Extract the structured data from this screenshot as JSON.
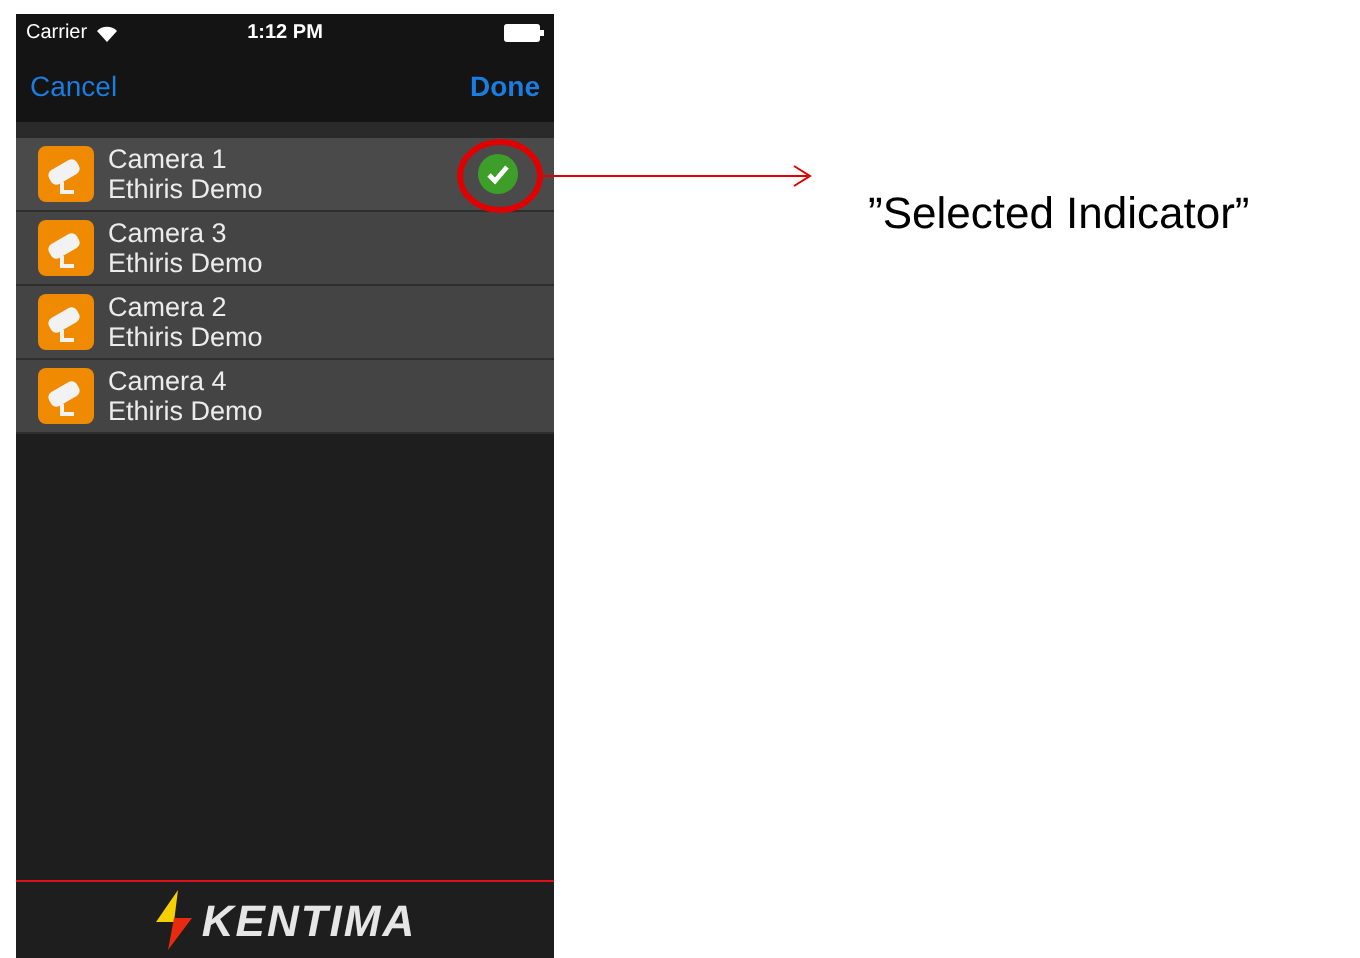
{
  "status_bar": {
    "carrier": "Carrier",
    "time": "1:12 PM"
  },
  "nav": {
    "cancel": "Cancel",
    "done": "Done"
  },
  "cameras": [
    {
      "name": "Camera 1",
      "subtitle": "Ethiris Demo",
      "selected": true
    },
    {
      "name": "Camera 3",
      "subtitle": "Ethiris Demo",
      "selected": false
    },
    {
      "name": "Camera 2",
      "subtitle": "Ethiris Demo",
      "selected": false
    },
    {
      "name": "Camera 4",
      "subtitle": "Ethiris Demo",
      "selected": false
    }
  ],
  "footer": {
    "logo_text": "KENTIMA"
  },
  "annotation": {
    "label": "”Selected Indicator”"
  }
}
